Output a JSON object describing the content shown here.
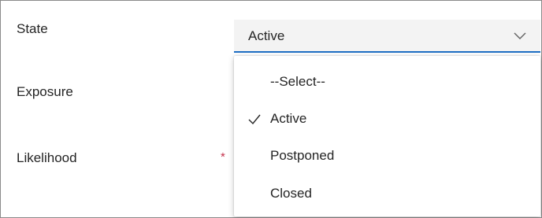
{
  "form": {
    "fields": {
      "state": {
        "label": "State",
        "value": "Active"
      },
      "exposure": {
        "label": "Exposure"
      },
      "likelihood": {
        "label": "Likelihood",
        "required_marker": "*"
      }
    }
  },
  "dropdown": {
    "options": [
      {
        "label": "--Select--",
        "selected": false
      },
      {
        "label": "Active",
        "selected": true
      },
      {
        "label": "Postponed",
        "selected": false
      },
      {
        "label": "Closed",
        "selected": false
      }
    ]
  },
  "colors": {
    "accent": "#1f6fc4",
    "required": "#c4314b",
    "field_background": "#f3f3f3"
  },
  "icons": {
    "select_chevron": "chevron-down-icon",
    "selected_marker": "checkmark-icon"
  }
}
